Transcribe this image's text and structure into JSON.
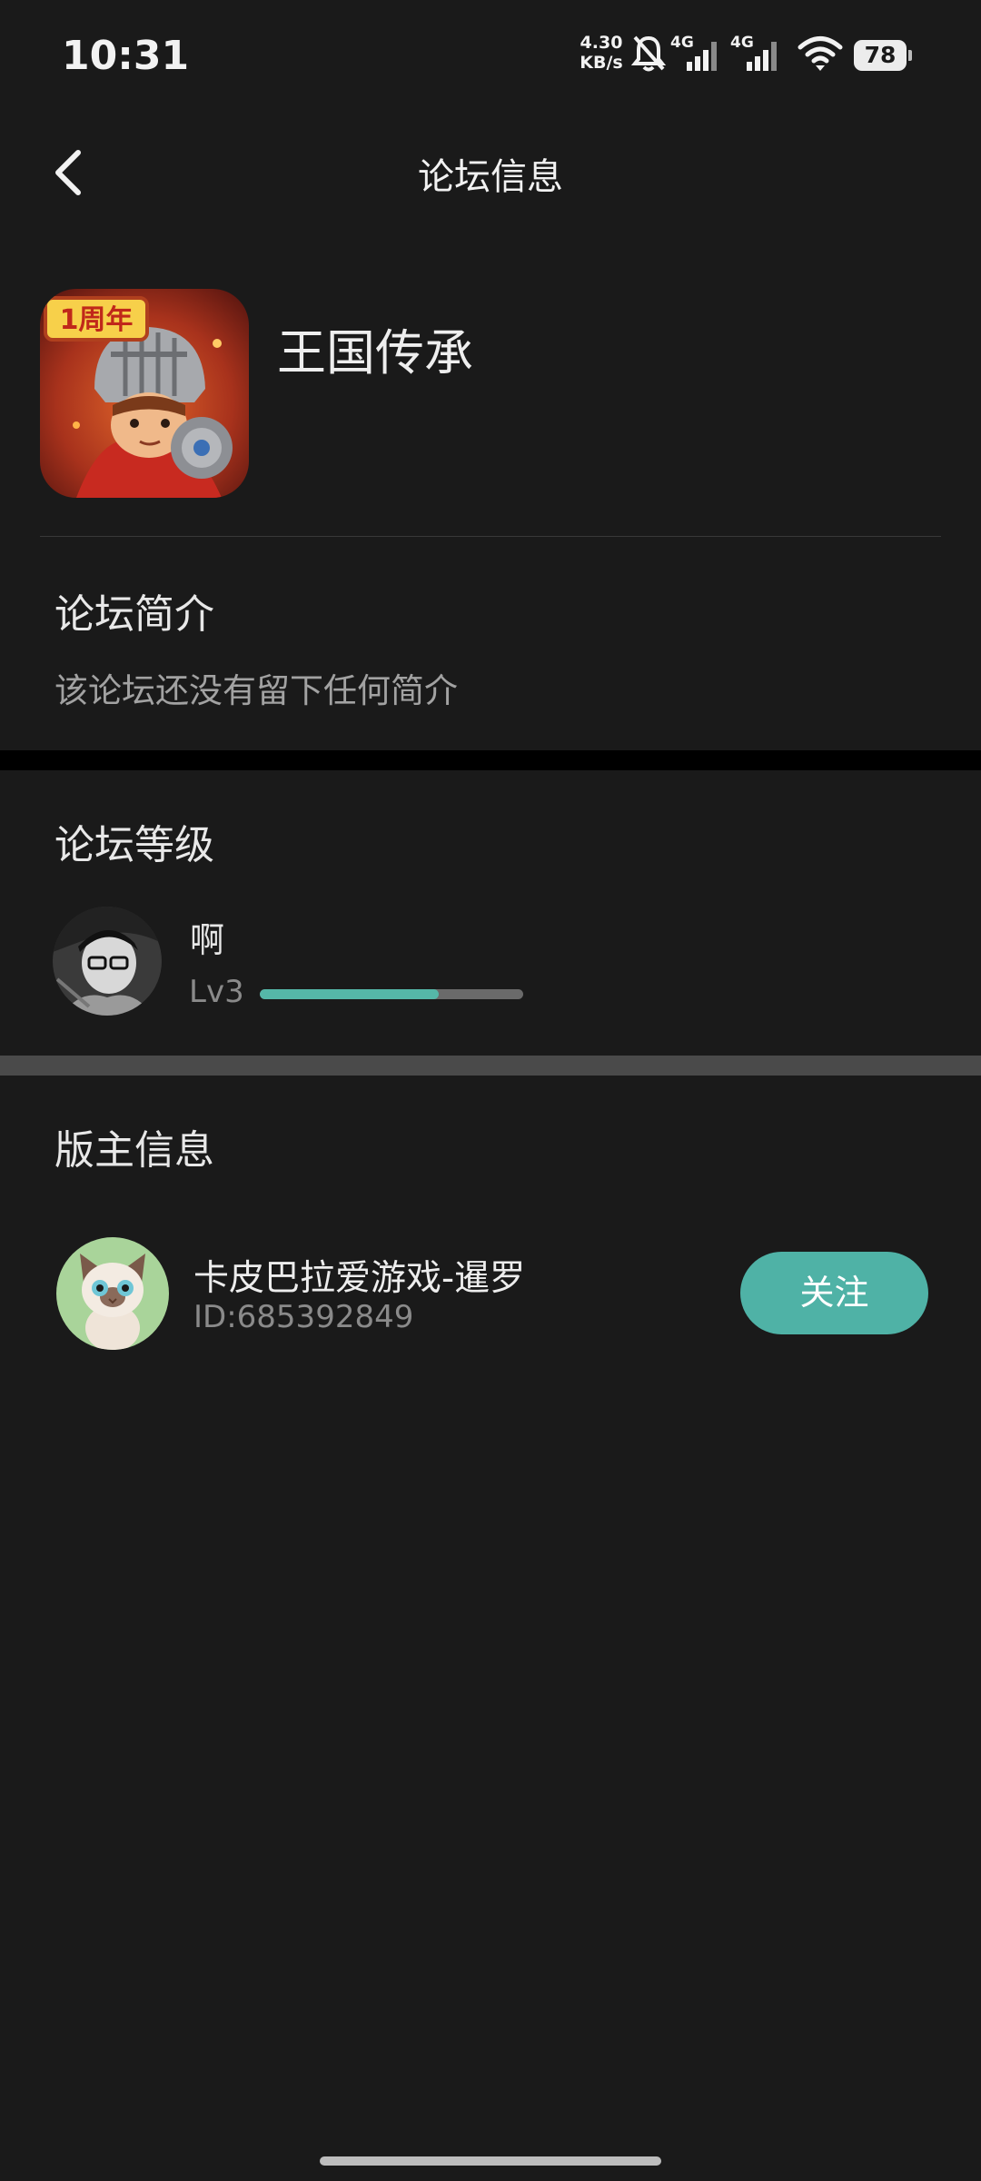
{
  "status_bar": {
    "time": "10:31",
    "net_speed_value": "4.30",
    "net_speed_unit": "KB/s",
    "signal_1_label": "4G",
    "signal_2_label": "4G",
    "battery": "78",
    "icons": [
      "bell-muted-icon",
      "signal-icon",
      "signal-icon",
      "wifi-icon",
      "battery-icon"
    ]
  },
  "header": {
    "title": "论坛信息",
    "back_icon": "chevron-left-icon"
  },
  "forum": {
    "icon_badge": "1周年",
    "name": "王国传承"
  },
  "intro": {
    "title": "论坛简介",
    "text": "该论坛还没有留下任何简介"
  },
  "level": {
    "title": "论坛等级",
    "user_name": "啊",
    "level_label": "Lv3",
    "progress": 0.68
  },
  "moderator": {
    "title": "版主信息",
    "name": "卡皮巴拉爱游戏-暹罗",
    "id_text": "ID:685392849",
    "follow_label": "关注"
  },
  "colors": {
    "background": "#1a1a1a",
    "accent": "#4fb2a6",
    "progress_fill": "#55b7a8"
  }
}
